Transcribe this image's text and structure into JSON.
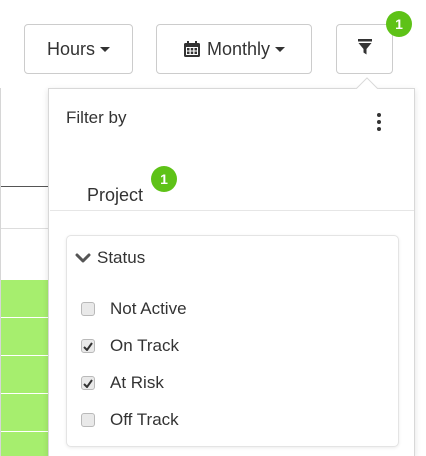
{
  "toolbar": {
    "hours_label": "Hours",
    "monthly_label": "Monthly",
    "filter_badge": "1"
  },
  "filter_panel": {
    "title": "Filter by",
    "tab": {
      "label": "Project",
      "badge": "1"
    },
    "status_group": {
      "label": "Status",
      "options": [
        {
          "label": "Not Active",
          "checked": false
        },
        {
          "label": "On Track",
          "checked": true
        },
        {
          "label": "At Risk",
          "checked": true
        },
        {
          "label": "Off Track",
          "checked": false
        }
      ]
    }
  },
  "colors": {
    "badge_green": "#5ec217",
    "row_green": "#a6ee6e",
    "border": "#cccccc",
    "text": "#333333"
  },
  "icons": {
    "calendar": "calendar-icon",
    "filter": "filter-icon",
    "kebab": "kebab-menu-icon",
    "chevron": "chevron-down-icon",
    "check": "check-icon"
  }
}
